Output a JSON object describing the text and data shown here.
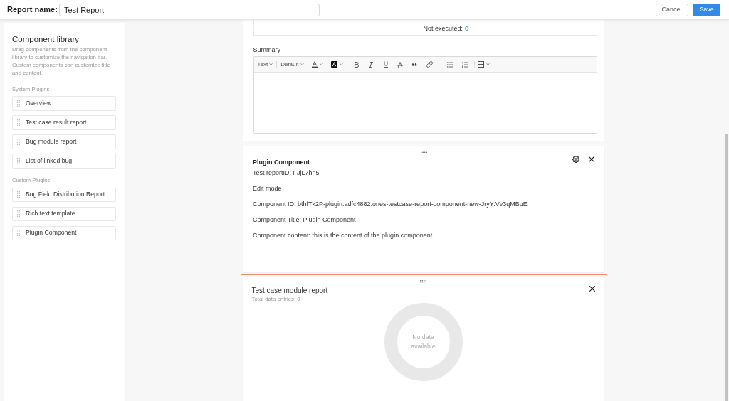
{
  "header": {
    "label": "Report name:",
    "report_name": "Test Report",
    "buttons": [
      {
        "label": "Cancel",
        "kind": "secondary"
      },
      {
        "label": "Save",
        "kind": "primary"
      }
    ]
  },
  "sidebar": {
    "title": "Component library",
    "description": "Drag components from the component library to customize the navigation bar. Custom components can customize title and content.",
    "groups": [
      {
        "title": "System Plugins",
        "items": [
          "Overview",
          "Test case result report",
          "Bug module report",
          "List of linked bug"
        ]
      },
      {
        "title": "Custom Plugins",
        "items": [
          "Bug Field Distribution Report",
          "Rich text template",
          "Plugin Component"
        ]
      }
    ]
  },
  "components": [
    {
      "kind": "summary",
      "selected": false,
      "results": [
        {
          "label": "Not executed:",
          "value": "0"
        }
      ],
      "label": "Summary",
      "toolbar": {
        "selects": [
          "Text",
          "Default"
        ]
      }
    },
    {
      "kind": "plugin",
      "selected": true,
      "title": "Plugin Component",
      "lines": [
        "Test reportID: FJjL7hn5",
        "Edit mode",
        "Component ID: bthfTk2P-plugin:adfc4882:ones-testcase-report-component-new-JryY:Vv3qMBuE",
        "Component Title: Plugin Component",
        "Component content: this is the content of the plugin component"
      ]
    },
    {
      "kind": "chart",
      "selected": false,
      "title": "Test case module report",
      "subtitle": "Total data entries: 0",
      "empty_text": "No data available"
    }
  ]
}
